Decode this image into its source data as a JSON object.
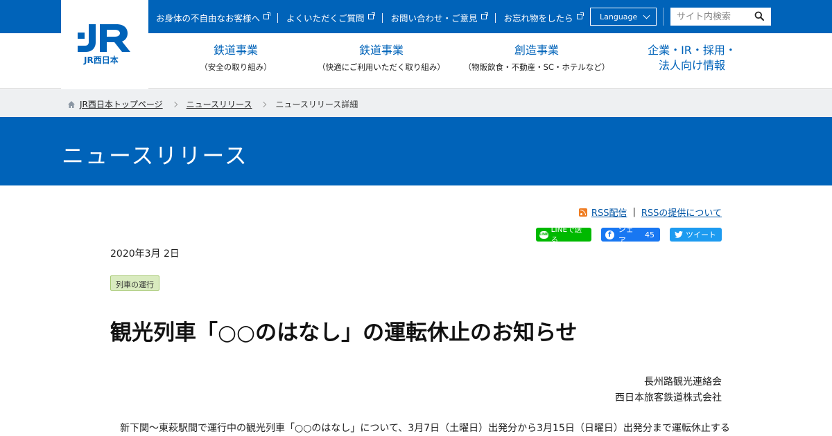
{
  "brand": {
    "logo_text": "JR西日本",
    "primary_color": "#0063b9"
  },
  "utility": {
    "links": [
      "お身体の不自由なお客様へ",
      "よくいただくご質問",
      "お問い合わせ・ご意見",
      "お忘れ物をしたら"
    ],
    "language_label": "Language",
    "search_placeholder": "サイト内検索"
  },
  "nav": [
    {
      "title": "鉄道事業",
      "sub": "（安全の取り組み）"
    },
    {
      "title": "鉄道事業",
      "sub": "（快適にご利用いただく取り組み）"
    },
    {
      "title": "創造事業",
      "sub": "（物販飲食・不動産・SC・ホテルなど）"
    },
    {
      "title_line1": "企業・IR・採用・",
      "title_line2": "法人向け情報"
    }
  ],
  "breadcrumb": {
    "home": "JR西日本トップページ",
    "section": "ニュースリリース",
    "current": "ニュースリリース詳細"
  },
  "band_title": "ニュースリリース",
  "rss": {
    "feed_label": "RSS配信",
    "about_label": "RSSの提供について"
  },
  "social": {
    "line_label": "LINEで送る",
    "fb_label": "シェア",
    "fb_count": "45",
    "tw_label": "ツイート",
    "line_badge": "LINE",
    "fb_badge": "f"
  },
  "article": {
    "date": "2020年3月 2日",
    "tag": "列車の運行",
    "title": "観光列車「○○のはなし」の運転休止のお知らせ",
    "signers": [
      "長州路観光連絡会",
      "西日本旅客鉄道株式会社"
    ],
    "body_first_line": "新下関～東萩駅間で運行中の観光列車「○○のはなし」について、3月7日（土曜日）出発分から3月15日（日曜日）出発分まで運転休止する"
  }
}
